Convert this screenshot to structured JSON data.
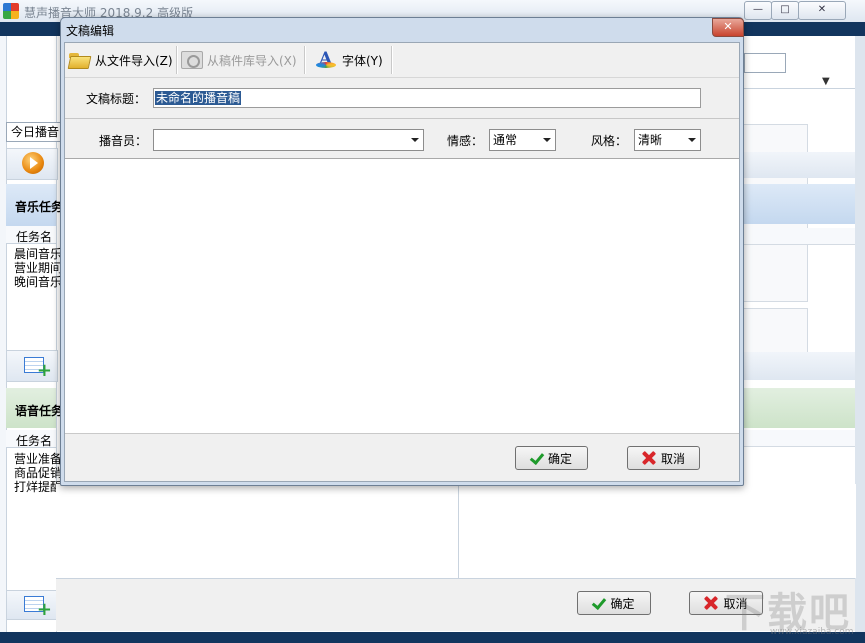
{
  "app": {
    "title": "慧声播音大师 2018.9.2 高级版",
    "today_tab": "今日播音",
    "music_section": {
      "title": "音乐任务",
      "col_header": "任务名",
      "items": [
        "晨间音乐",
        "营业期间",
        "晚间音乐"
      ]
    },
    "voice_section": {
      "title": "语音任务",
      "col_header": "任务名",
      "items": [
        "营业准备",
        "商品促销",
        "打烊提醒"
      ]
    },
    "window_buttons": {
      "minimize": "—",
      "maximize": "□",
      "close": "✕"
    },
    "ok_label": "确定",
    "cancel_label": "取消"
  },
  "dialog": {
    "title": "文稿编辑",
    "close": "✕",
    "toolbar": {
      "import_file": "从文件导入(Z)",
      "import_library": "从稿件库导入(X)",
      "font": "字体(Y)"
    },
    "title_label": "文稿标题：",
    "title_value": "未命名的播音稿",
    "announcer_label": "播音员：",
    "announcer_value": "",
    "emotion_label": "情感：",
    "emotion_value": "通常",
    "style_label": "风格：",
    "style_value": "清晰",
    "content": "",
    "ok_label": "确定",
    "cancel_label": "取消"
  },
  "watermark": {
    "text": "下载吧",
    "url": "www.xiazaiba.com"
  },
  "colors": {
    "dialog_frame": "#cfdcec",
    "header_band": "#12355e",
    "selection": "#2c5a93",
    "ok_check": "#1e9a2b",
    "cancel_x": "#d8262a"
  }
}
